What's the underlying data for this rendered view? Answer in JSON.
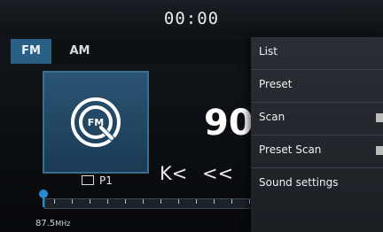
{
  "status_bar": {
    "time": "00:00"
  },
  "tabs": [
    {
      "label": "FM",
      "active": true
    },
    {
      "label": "AM",
      "active": false
    }
  ],
  "station": {
    "logo_text": "FM",
    "frequency_partial": "90",
    "preset": "P1"
  },
  "controls": {
    "seek_back": "K<",
    "tune_back": "<<"
  },
  "dial": {
    "start_label": "87.5",
    "unit": "MHz"
  },
  "menu": {
    "items": [
      {
        "label": "List"
      },
      {
        "label": "Preset"
      },
      {
        "label": "Scan",
        "has_toggle": true
      },
      {
        "label": "Preset Scan",
        "has_toggle": true
      },
      {
        "label": "Sound settings"
      }
    ]
  },
  "colors": {
    "accent": "#2a5f86",
    "marker": "#2a8ad0",
    "menu_bg": "#23282e"
  }
}
